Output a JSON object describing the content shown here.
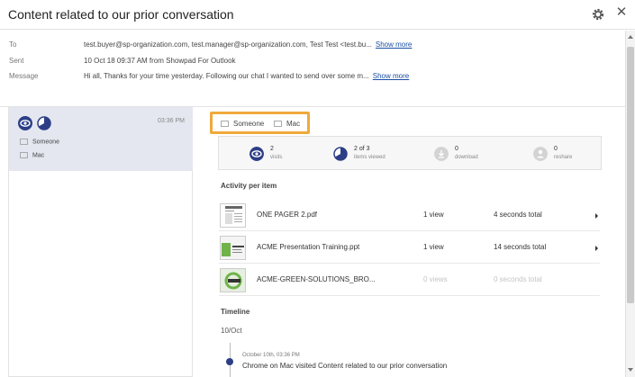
{
  "window": {
    "title": "Content related to our prior conversation",
    "settings_icon": "gear-icon",
    "close_label": "✕"
  },
  "email": {
    "to_label": "To",
    "to_value": "test.buyer@sp-organization.com, test.manager@sp-organization.com, Test Test <test.bu...",
    "to_show_more": "Show more",
    "sent_label": "Sent",
    "sent_value": "10 Oct 18 09:37 AM from Showpad For Outlook",
    "message_label": "Message",
    "message_value": "Hi all, Thanks for your time yesterday. Following our chat I wanted to send over some m...",
    "message_show_more": "Show more"
  },
  "sidebar": {
    "session": {
      "time": "03:36 PM",
      "viewer": "Someone",
      "device": "Mac"
    }
  },
  "session_header": {
    "viewer": "Someone",
    "device": "Mac",
    "highlight_color": "#f0a93b"
  },
  "stats": [
    {
      "value": "2",
      "label": "visits",
      "icon": "eye-icon"
    },
    {
      "value": "2 of 3",
      "label": "items viewed",
      "icon": "pie-icon"
    },
    {
      "value": "0",
      "label": "download",
      "icon": "download-icon"
    },
    {
      "value": "0",
      "label": "reshare",
      "icon": "reshare-icon"
    }
  ],
  "activity": {
    "heading": "Activity per item",
    "items": [
      {
        "name": "ONE PAGER 2.pdf",
        "views": "1 view",
        "duration": "4 seconds total"
      },
      {
        "name": "ACME Presentation Training.ppt",
        "views": "1 view",
        "duration": "14 seconds total"
      },
      {
        "name": "ACME-GREEN-SOLUTIONS_BRO...",
        "views": "0 views",
        "duration": "0 seconds total"
      }
    ]
  },
  "timeline": {
    "heading": "Timeline",
    "date": "10/Oct",
    "events": [
      {
        "time": "October 10th, 03:36 PM",
        "text": "Chrome on Mac visited Content related to our prior conversation"
      }
    ]
  },
  "colors": {
    "accent": "#2c3e86",
    "selected_bg": "#e4e7f0",
    "link": "#1a4fa3"
  }
}
